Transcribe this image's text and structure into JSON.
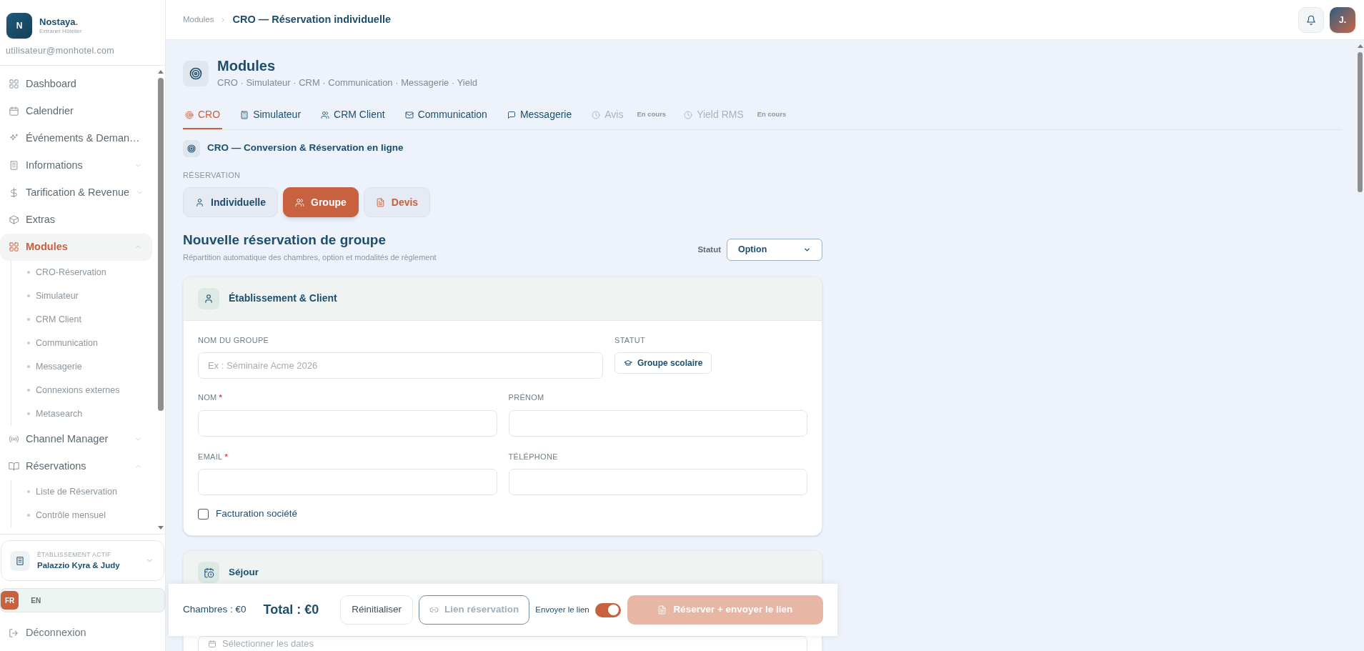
{
  "brand": {
    "initial": "N",
    "name": "Nostaya",
    "name_dot": ".",
    "subtitle": "Extranet Hôtelier",
    "email": "utilisateur@monhotel.com"
  },
  "sidebar": {
    "items": [
      {
        "label": "Dashboard",
        "selected": false
      },
      {
        "label": "Calendrier",
        "selected": false
      },
      {
        "label": "Événements & Deman…",
        "selected": false
      },
      {
        "label": "Informations",
        "selected": false,
        "expanded": false
      },
      {
        "label": "Tarification & Revenue",
        "selected": false,
        "expanded": false
      },
      {
        "label": "Extras",
        "selected": false
      },
      {
        "label": "Modules",
        "selected": true,
        "expanded": true,
        "children": [
          {
            "label": "CRO-Réservation"
          },
          {
            "label": "Simulateur"
          },
          {
            "label": "CRM Client"
          },
          {
            "label": "Communication"
          },
          {
            "label": "Messagerie"
          },
          {
            "label": "Connexions externes"
          },
          {
            "label": "Metasearch"
          }
        ]
      },
      {
        "label": "Channel Manager",
        "selected": false,
        "expanded": false
      },
      {
        "label": "Réservations",
        "selected": false,
        "expanded": true,
        "children": [
          {
            "label": "Liste de Réservation"
          },
          {
            "label": "Contrôle mensuel"
          }
        ]
      }
    ],
    "establishment": {
      "label": "ÉTABLISSEMENT ACTIF",
      "name": "Palazzio Kyra & Judy"
    },
    "languages": [
      {
        "label": "FR",
        "selected": true
      },
      {
        "label": "EN",
        "selected": false
      }
    ],
    "logout": "Déconnexion"
  },
  "header": {
    "breadcrumb": [
      "Modules",
      "CRO — Réservation individuelle"
    ],
    "avatar": "J."
  },
  "page": {
    "title": "Modules",
    "subtitle": "CRO · Simulateur · CRM · Communication · Messagerie · Yield"
  },
  "tabs": [
    {
      "label": "CRO",
      "selected": true,
      "disabled": false
    },
    {
      "label": "Simulateur",
      "selected": false,
      "disabled": false
    },
    {
      "label": "CRM Client",
      "selected": false,
      "disabled": false
    },
    {
      "label": "Communication",
      "selected": false,
      "disabled": false
    },
    {
      "label": "Messagerie",
      "selected": false,
      "disabled": false
    },
    {
      "label": "Avis",
      "selected": false,
      "disabled": true,
      "badge": "En cours"
    },
    {
      "label": "Yield RMS",
      "selected": false,
      "disabled": true,
      "badge": "En cours"
    }
  ],
  "section": {
    "title": "CRO — Conversion & Réservation en ligne",
    "group_label": "RÉSERVATION",
    "types": [
      {
        "label": "Individuelle",
        "selected": false,
        "kind": "booking"
      },
      {
        "label": "Groupe",
        "selected": true,
        "kind": "booking"
      },
      {
        "label": "Devis",
        "selected": false,
        "kind": "quote"
      }
    ]
  },
  "form": {
    "title": "Nouvelle réservation de groupe",
    "subtitle": "Répartition automatique des chambres, option et modalités de règlement",
    "status_label": "Statut",
    "status_value": "Option",
    "client_card": {
      "title": "Établissement & Client",
      "group_name": {
        "label": "NOM DU GROUPE",
        "placeholder": "Ex : Séminaire Acme 2026"
      },
      "status": {
        "label": "STATUT",
        "chip": "Groupe scolaire"
      },
      "required_mark": "*",
      "fields": [
        {
          "label": "NOM",
          "required": true
        },
        {
          "label": "PRÉNOM",
          "required": false
        },
        {
          "label": "EMAIL",
          "required": true
        },
        {
          "label": "TÉLÉPHONE",
          "required": false
        }
      ],
      "checkbox": {
        "label": "Facturation société",
        "checked": false
      }
    },
    "stay_card": {
      "title": "Séjour",
      "date_placeholder": "Sélectionner les dates"
    }
  },
  "footer": {
    "rooms": "Chambres : €0",
    "total": "Total : €0",
    "reset": "Réinitialiser",
    "link": "Lien réservation",
    "send_label": "Envoyer le lien",
    "send_on": true,
    "submit": "Réserver + envoyer le lien",
    "submit_disabled": true
  }
}
